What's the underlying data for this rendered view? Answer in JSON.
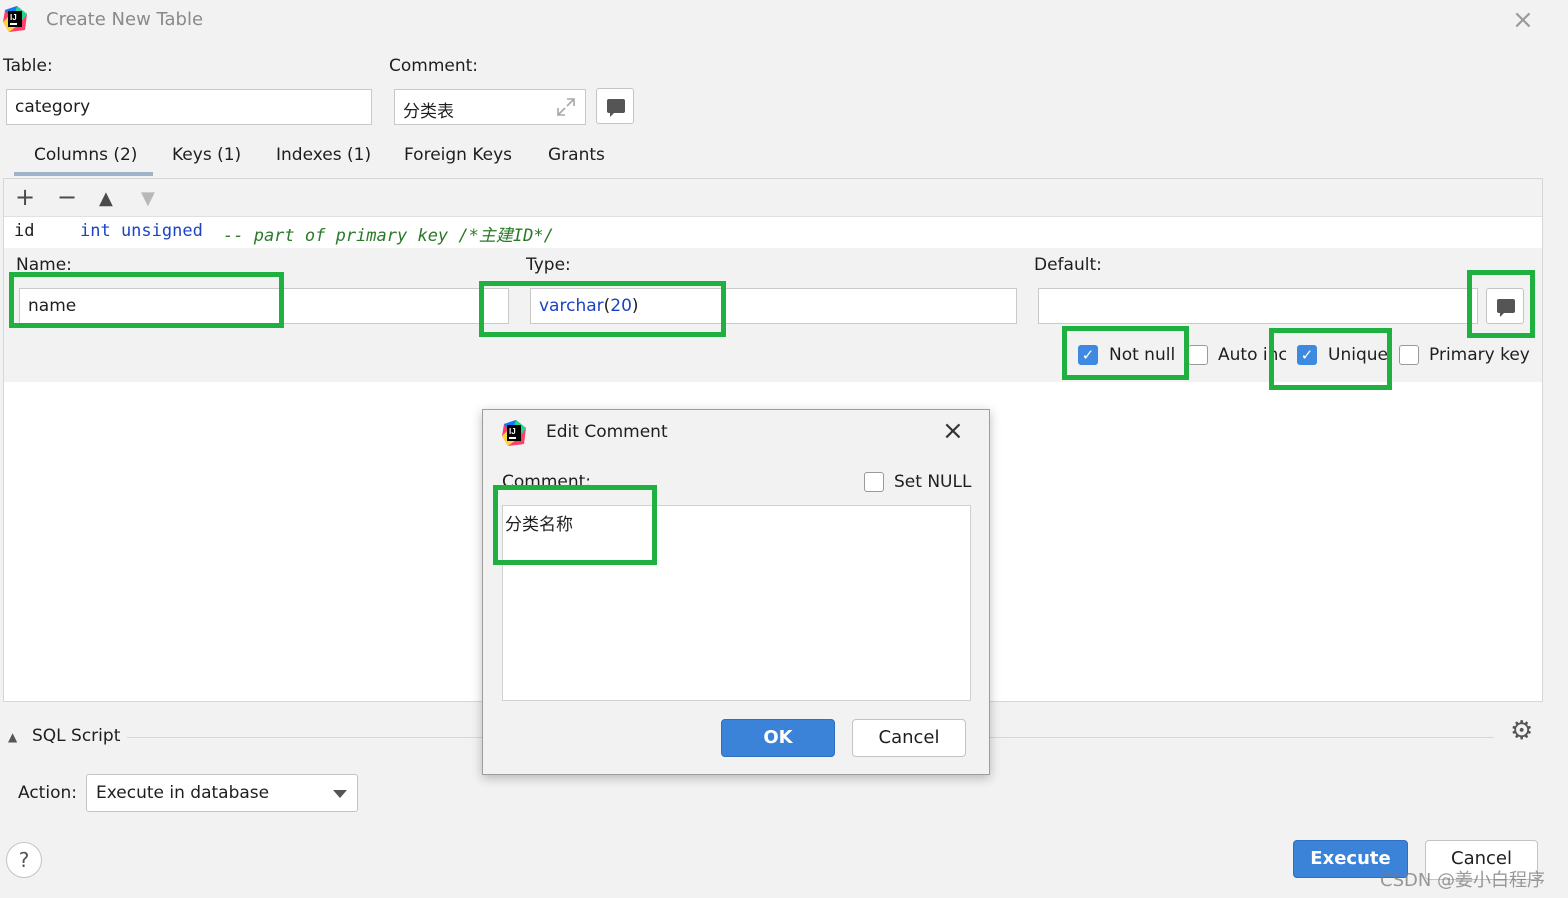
{
  "window": {
    "title": "Create New Table",
    "close_glyph": "×"
  },
  "table_label": "Table:",
  "table_name": "category",
  "comment_label": "Comment:",
  "table_comment": "分类表",
  "tabs": [
    {
      "label": "Columns (2)"
    },
    {
      "label": "Keys (1)"
    },
    {
      "label": "Indexes (1)"
    },
    {
      "label": "Foreign Keys"
    },
    {
      "label": "Grants"
    }
  ],
  "toolbar": {
    "add": "+",
    "remove": "−",
    "up": "▲",
    "down": "▼"
  },
  "column_row": {
    "name": "id",
    "type": "int unsigned",
    "comment": "-- part of primary key /*主建ID*/"
  },
  "column_editor": {
    "name_label": "Name:",
    "name_value": "name",
    "type_label": "Type:",
    "type_base": "varchar",
    "type_open": "(",
    "type_length": "20",
    "type_close": ")",
    "default_label": "Default:",
    "default_value": "",
    "checkboxes": {
      "not_null": {
        "label": "Not null",
        "checked": true
      },
      "auto_inc": {
        "label": "Auto inc",
        "checked": false
      },
      "unique": {
        "label": "Unique",
        "checked": true
      },
      "primary_key": {
        "label": "Primary key",
        "checked": false
      }
    }
  },
  "sql_section": {
    "label": "SQL Script",
    "toggle_glyph": "▲",
    "settings_glyph": "⚙"
  },
  "action": {
    "label": "Action:",
    "value": "Execute in database"
  },
  "help_glyph": "?",
  "buttons": {
    "execute": "Execute",
    "cancel": "Cancel"
  },
  "watermark": "CSDN @姜小白程序",
  "dialog": {
    "title": "Edit Comment",
    "close_glyph": "×",
    "comment_label": "Comment:",
    "set_null_label": "Set NULL",
    "set_null_checked": false,
    "comment_text": "分类名称",
    "ok_label": "OK",
    "cancel_label": "Cancel"
  },
  "colors": {
    "highlight": "#1fb040",
    "accent": "#3b82d9",
    "type_blue": "#1c43c4",
    "comment_green": "#2a7a2a"
  },
  "icons": [
    "app-logo-icon",
    "close-icon",
    "add-icon",
    "remove-icon",
    "move-up-icon",
    "move-down-icon",
    "expand-icon",
    "comment-icon",
    "collapse-icon",
    "gear-icon",
    "dropdown-arrow-icon",
    "help-icon",
    "checkmark-icon"
  ]
}
